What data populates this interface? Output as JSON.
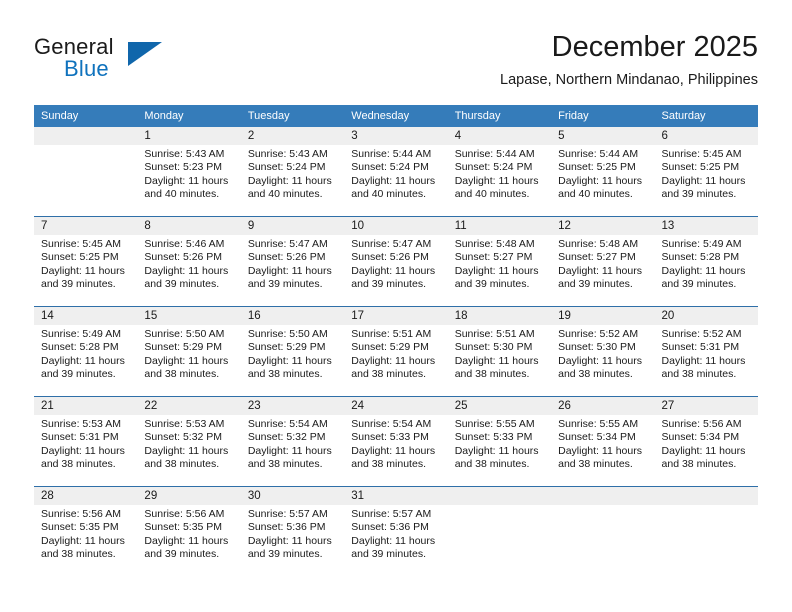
{
  "brand": {
    "name_part1": "General",
    "name_part2": "Blue"
  },
  "header": {
    "title": "December 2025",
    "subtitle": "Lapase, Northern Mindanao, Philippines"
  },
  "colors": {
    "header_row_bg": "#357cba",
    "brand_blue": "#0f72bd",
    "daynum_band_bg": "#efefef",
    "week_divider": "#2f6fa8",
    "text": "#1a1a1a"
  },
  "weekday_headers": [
    "Sunday",
    "Monday",
    "Tuesday",
    "Wednesday",
    "Thursday",
    "Friday",
    "Saturday"
  ],
  "labels": {
    "sunrise_prefix": "Sunrise:",
    "sunset_prefix": "Sunset:",
    "daylight_prefix": "Daylight:"
  },
  "weeks": [
    [
      {
        "day": "",
        "empty": true
      },
      {
        "day": "1",
        "line1": "Sunrise: 5:43 AM",
        "line2": "Sunset: 5:23 PM",
        "line3": "Daylight: 11 hours and 40 minutes."
      },
      {
        "day": "2",
        "line1": "Sunrise: 5:43 AM",
        "line2": "Sunset: 5:24 PM",
        "line3": "Daylight: 11 hours and 40 minutes."
      },
      {
        "day": "3",
        "line1": "Sunrise: 5:44 AM",
        "line2": "Sunset: 5:24 PM",
        "line3": "Daylight: 11 hours and 40 minutes."
      },
      {
        "day": "4",
        "line1": "Sunrise: 5:44 AM",
        "line2": "Sunset: 5:24 PM",
        "line3": "Daylight: 11 hours and 40 minutes."
      },
      {
        "day": "5",
        "line1": "Sunrise: 5:44 AM",
        "line2": "Sunset: 5:25 PM",
        "line3": "Daylight: 11 hours and 40 minutes."
      },
      {
        "day": "6",
        "line1": "Sunrise: 5:45 AM",
        "line2": "Sunset: 5:25 PM",
        "line3": "Daylight: 11 hours and 39 minutes."
      }
    ],
    [
      {
        "day": "7",
        "line1": "Sunrise: 5:45 AM",
        "line2": "Sunset: 5:25 PM",
        "line3": "Daylight: 11 hours and 39 minutes."
      },
      {
        "day": "8",
        "line1": "Sunrise: 5:46 AM",
        "line2": "Sunset: 5:26 PM",
        "line3": "Daylight: 11 hours and 39 minutes."
      },
      {
        "day": "9",
        "line1": "Sunrise: 5:47 AM",
        "line2": "Sunset: 5:26 PM",
        "line3": "Daylight: 11 hours and 39 minutes."
      },
      {
        "day": "10",
        "line1": "Sunrise: 5:47 AM",
        "line2": "Sunset: 5:26 PM",
        "line3": "Daylight: 11 hours and 39 minutes."
      },
      {
        "day": "11",
        "line1": "Sunrise: 5:48 AM",
        "line2": "Sunset: 5:27 PM",
        "line3": "Daylight: 11 hours and 39 minutes."
      },
      {
        "day": "12",
        "line1": "Sunrise: 5:48 AM",
        "line2": "Sunset: 5:27 PM",
        "line3": "Daylight: 11 hours and 39 minutes."
      },
      {
        "day": "13",
        "line1": "Sunrise: 5:49 AM",
        "line2": "Sunset: 5:28 PM",
        "line3": "Daylight: 11 hours and 39 minutes."
      }
    ],
    [
      {
        "day": "14",
        "line1": "Sunrise: 5:49 AM",
        "line2": "Sunset: 5:28 PM",
        "line3": "Daylight: 11 hours and 39 minutes."
      },
      {
        "day": "15",
        "line1": "Sunrise: 5:50 AM",
        "line2": "Sunset: 5:29 PM",
        "line3": "Daylight: 11 hours and 38 minutes."
      },
      {
        "day": "16",
        "line1": "Sunrise: 5:50 AM",
        "line2": "Sunset: 5:29 PM",
        "line3": "Daylight: 11 hours and 38 minutes."
      },
      {
        "day": "17",
        "line1": "Sunrise: 5:51 AM",
        "line2": "Sunset: 5:29 PM",
        "line3": "Daylight: 11 hours and 38 minutes."
      },
      {
        "day": "18",
        "line1": "Sunrise: 5:51 AM",
        "line2": "Sunset: 5:30 PM",
        "line3": "Daylight: 11 hours and 38 minutes."
      },
      {
        "day": "19",
        "line1": "Sunrise: 5:52 AM",
        "line2": "Sunset: 5:30 PM",
        "line3": "Daylight: 11 hours and 38 minutes."
      },
      {
        "day": "20",
        "line1": "Sunrise: 5:52 AM",
        "line2": "Sunset: 5:31 PM",
        "line3": "Daylight: 11 hours and 38 minutes."
      }
    ],
    [
      {
        "day": "21",
        "line1": "Sunrise: 5:53 AM",
        "line2": "Sunset: 5:31 PM",
        "line3": "Daylight: 11 hours and 38 minutes."
      },
      {
        "day": "22",
        "line1": "Sunrise: 5:53 AM",
        "line2": "Sunset: 5:32 PM",
        "line3": "Daylight: 11 hours and 38 minutes."
      },
      {
        "day": "23",
        "line1": "Sunrise: 5:54 AM",
        "line2": "Sunset: 5:32 PM",
        "line3": "Daylight: 11 hours and 38 minutes."
      },
      {
        "day": "24",
        "line1": "Sunrise: 5:54 AM",
        "line2": "Sunset: 5:33 PM",
        "line3": "Daylight: 11 hours and 38 minutes."
      },
      {
        "day": "25",
        "line1": "Sunrise: 5:55 AM",
        "line2": "Sunset: 5:33 PM",
        "line3": "Daylight: 11 hours and 38 minutes."
      },
      {
        "day": "26",
        "line1": "Sunrise: 5:55 AM",
        "line2": "Sunset: 5:34 PM",
        "line3": "Daylight: 11 hours and 38 minutes."
      },
      {
        "day": "27",
        "line1": "Sunrise: 5:56 AM",
        "line2": "Sunset: 5:34 PM",
        "line3": "Daylight: 11 hours and 38 minutes."
      }
    ],
    [
      {
        "day": "28",
        "line1": "Sunrise: 5:56 AM",
        "line2": "Sunset: 5:35 PM",
        "line3": "Daylight: 11 hours and 38 minutes."
      },
      {
        "day": "29",
        "line1": "Sunrise: 5:56 AM",
        "line2": "Sunset: 5:35 PM",
        "line3": "Daylight: 11 hours and 39 minutes."
      },
      {
        "day": "30",
        "line1": "Sunrise: 5:57 AM",
        "line2": "Sunset: 5:36 PM",
        "line3": "Daylight: 11 hours and 39 minutes."
      },
      {
        "day": "31",
        "line1": "Sunrise: 5:57 AM",
        "line2": "Sunset: 5:36 PM",
        "line3": "Daylight: 11 hours and 39 minutes."
      },
      {
        "day": "",
        "empty": true
      },
      {
        "day": "",
        "empty": true
      },
      {
        "day": "",
        "empty": true
      }
    ]
  ]
}
